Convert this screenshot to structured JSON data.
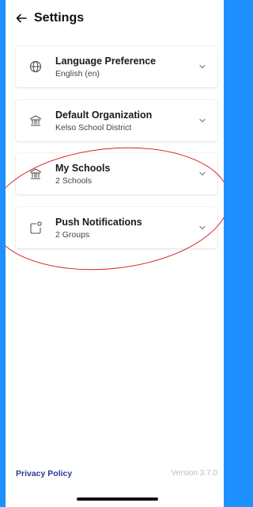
{
  "header": {
    "title": "Settings",
    "back_icon": "back-arrow-icon"
  },
  "cards": [
    {
      "label": "Language Preference",
      "sub": "English (en)",
      "icon": "globe-icon"
    },
    {
      "label": "Default Organization",
      "sub": "Kelso School District",
      "icon": "school-icon"
    },
    {
      "label": "My Schools",
      "sub": "2 Schools",
      "icon": "school-icon"
    },
    {
      "label": "Push Notifications",
      "sub": "2 Groups",
      "icon": "notification-icon"
    }
  ],
  "footer": {
    "privacy": "Privacy Policy",
    "version": "Version 3.7.0"
  },
  "colors": {
    "frame": "#1e90ff",
    "annotation": "#d81e1e",
    "link": "#2b3a8f"
  }
}
